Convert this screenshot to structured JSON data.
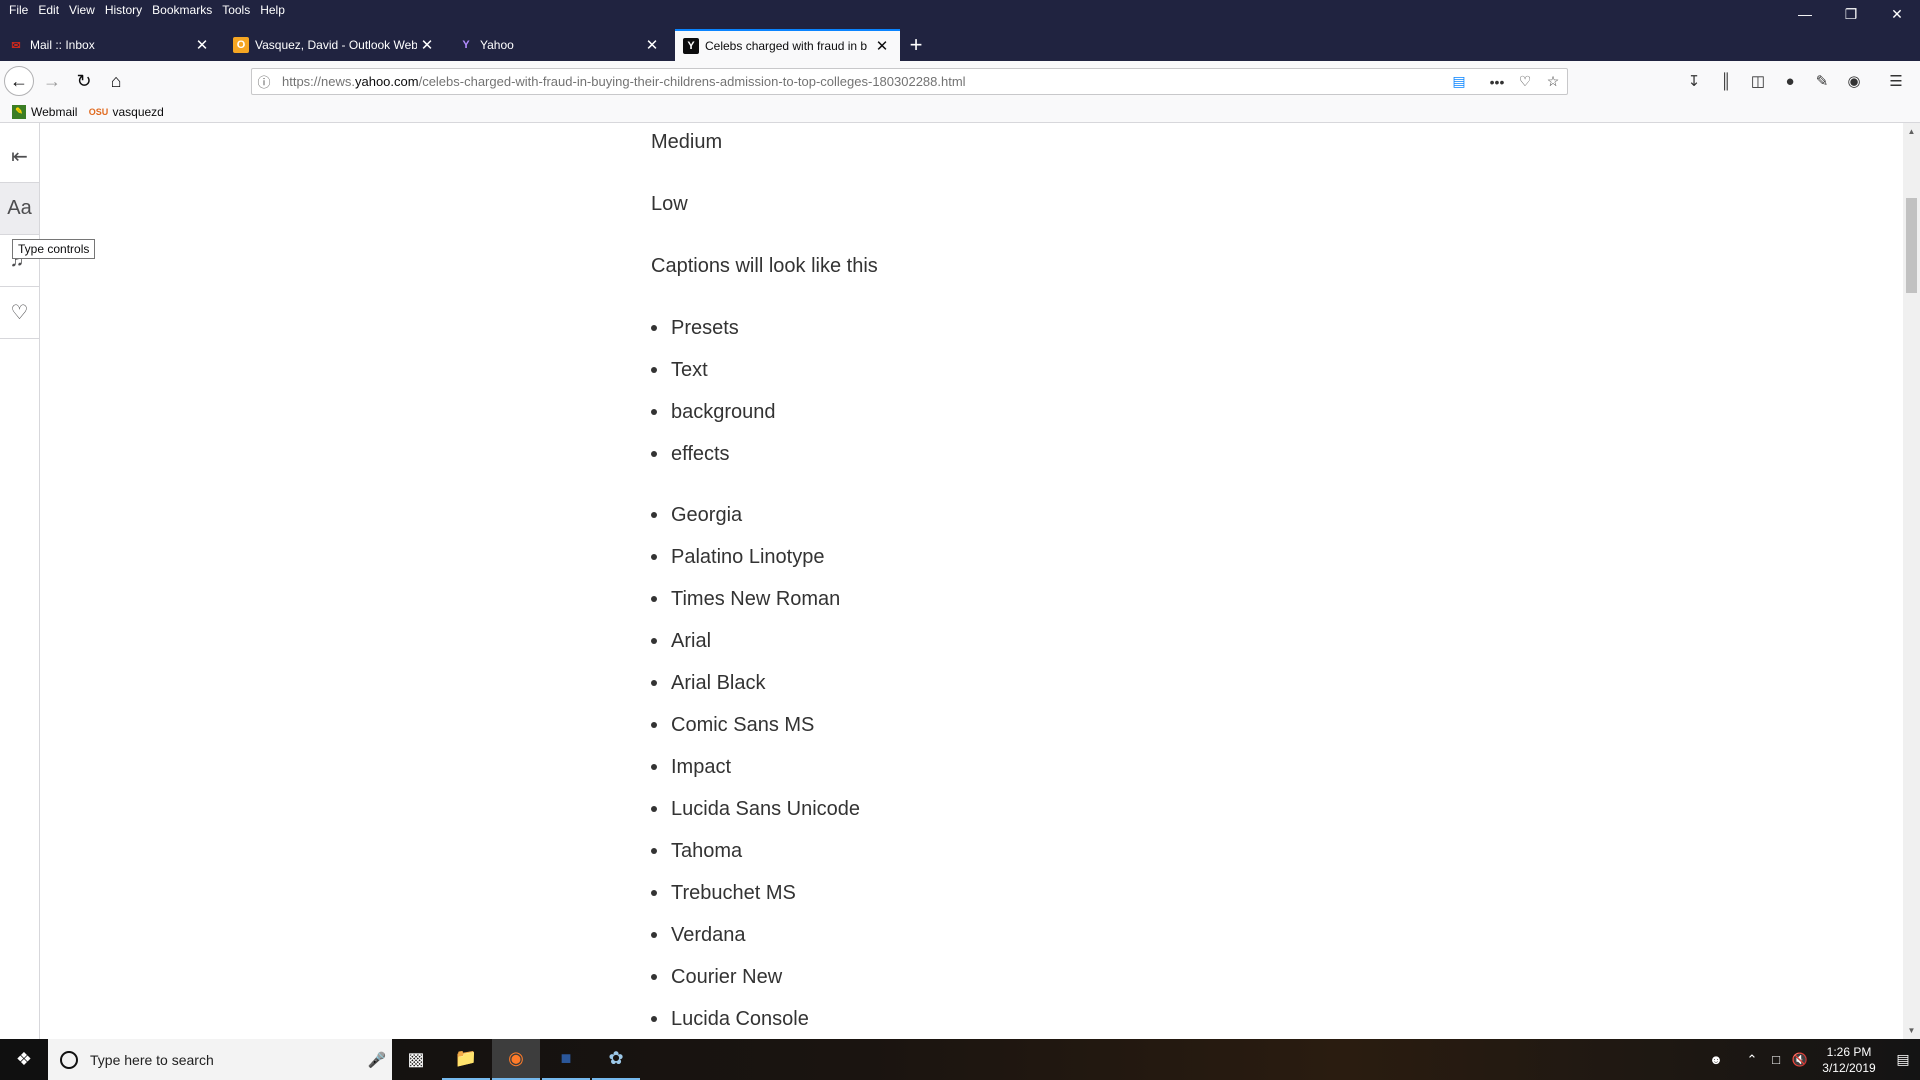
{
  "menu": [
    "File",
    "Edit",
    "View",
    "History",
    "Bookmarks",
    "Tools",
    "Help"
  ],
  "tabs": [
    {
      "title": "Mail :: Inbox",
      "icon": "mail-icon",
      "icon_color": "#c8281d",
      "active": false
    },
    {
      "title": "Vasquez, David - Outlook Web",
      "icon": "outlook-icon",
      "icon_color": "#f5a623",
      "active": false
    },
    {
      "title": "Yahoo",
      "icon": "yahoo-icon",
      "icon_color": "#6001d2",
      "active": false
    },
    {
      "title": "Celebs charged with fraud in b",
      "icon": "yahoo-news-icon",
      "icon_color": "#0c0c0d",
      "active": true
    }
  ],
  "url": {
    "prefix": "https://news.",
    "domain": "yahoo.com",
    "path": "/celebs-charged-with-fraud-in-buying-their-childrens-admission-to-top-colleges-180302288.html"
  },
  "bookmarks": [
    {
      "label": "Webmail",
      "icon": "webmail-icon"
    },
    {
      "label": "vasquezd",
      "icon": "osu-icon",
      "icon_text": "OSU"
    }
  ],
  "reader": {
    "tooltip": "Type controls",
    "type_controls_label": "Aa"
  },
  "article": {
    "paragraphs": [
      "Medium",
      "Low",
      "Captions will look like this"
    ],
    "list1": [
      "Presets",
      "Text",
      "background",
      "effects"
    ],
    "list2": [
      "Georgia",
      "Palatino Linotype",
      "Times New Roman",
      "Arial",
      "Arial Black",
      "Comic Sans MS",
      "Impact",
      "Lucida Sans Unicode",
      "Tahoma",
      "Trebuchet MS",
      "Verdana",
      "Courier New",
      "Lucida Console"
    ]
  },
  "taskbar": {
    "search_placeholder": "Type here to search",
    "time": "1:26 PM",
    "date": "3/12/2019"
  },
  "colors": {
    "accent": "#0a84ff",
    "titlebar": "#202340"
  }
}
